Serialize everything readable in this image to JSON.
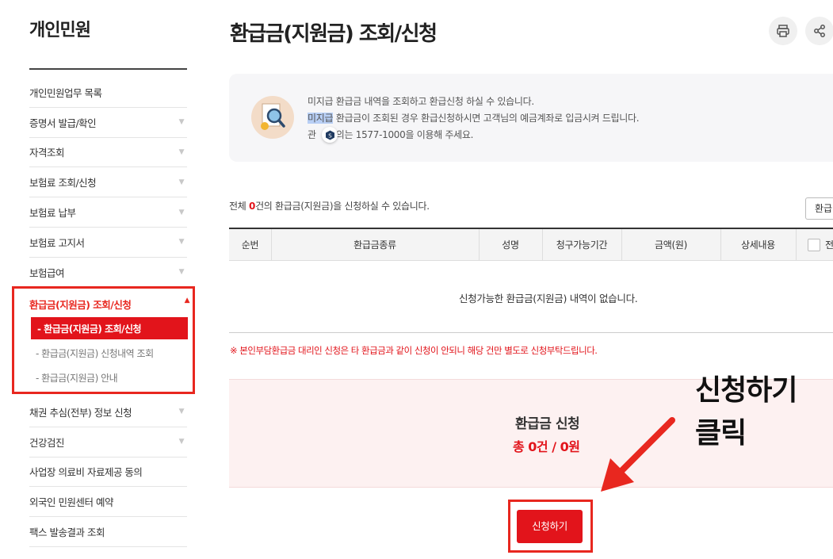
{
  "sidebar": {
    "title": "개인민원",
    "items_top": [
      {
        "label": "개인민원업무 목록",
        "has_caret": false
      },
      {
        "label": "증명서 발급/확인",
        "has_caret": true
      },
      {
        "label": "자격조회",
        "has_caret": true
      },
      {
        "label": "보험료 조회/신청",
        "has_caret": true
      },
      {
        "label": "보험료 납부",
        "has_caret": true
      },
      {
        "label": "보험료 고지서",
        "has_caret": true
      },
      {
        "label": "보험급여",
        "has_caret": true
      }
    ],
    "active_group": {
      "label": "환급금(지원금) 조회/신청",
      "sub_active": "-  환급금(지원금) 조회/신청",
      "sub_items": [
        "-  환급금(지원금) 신청내역 조회",
        "-  환급금(지원금) 안내"
      ]
    },
    "items_bottom": [
      {
        "label": "채권 추심(전부) 정보 신청",
        "has_caret": true
      },
      {
        "label": "건강검진",
        "has_caret": true
      },
      {
        "label": "사업장 의료비 자료제공 동의",
        "has_caret": false
      },
      {
        "label": "외국인 민원센터 예약",
        "has_caret": false
      },
      {
        "label": "팩스 발송결과 조회",
        "has_caret": false
      }
    ]
  },
  "header": {
    "title": "환급금(지원금) 조회/신청",
    "print_icon": "printer-icon",
    "share_icon": "share-icon"
  },
  "info": {
    "line1": "미지급 환급금 내역을 조회하고 환급신청 하실 수 있습니다.",
    "line2_highlight": "미지급",
    "line2_rest": " 환급금이 조회된 경우 환급신청하시면 고객님의 예금계좌로 입금시켜 드립니다.",
    "line3_pre": "관",
    "line3_post": "의는 1577-1000을 이용해 주세요."
  },
  "table": {
    "count_prefix": "전체 ",
    "count_value": "0",
    "count_suffix": "건의 환급금(지원금)을 신청하실 수 있습니다.",
    "top_button": "환급",
    "headers": [
      "순번",
      "환급금종류",
      "성명",
      "청구가능기간",
      "금액(원)",
      "상세내용",
      "전"
    ],
    "empty_message": "신청가능한 환급금(지원금) 내역이 없습니다."
  },
  "notice": "※ 본인부담환급금 대리인 신청은 타 환급금과 같이 신청이 안되니 해당 건만 별도로 신청부탁드립니다.",
  "summary": {
    "title": "환급금 신청",
    "total": "총 0건 / 0원"
  },
  "apply_button": "신청하기",
  "annotation": {
    "line1": "신청하기",
    "line2": "클릭"
  },
  "colors": {
    "accent": "#e2141b",
    "annotation_frame": "#e8271f"
  }
}
